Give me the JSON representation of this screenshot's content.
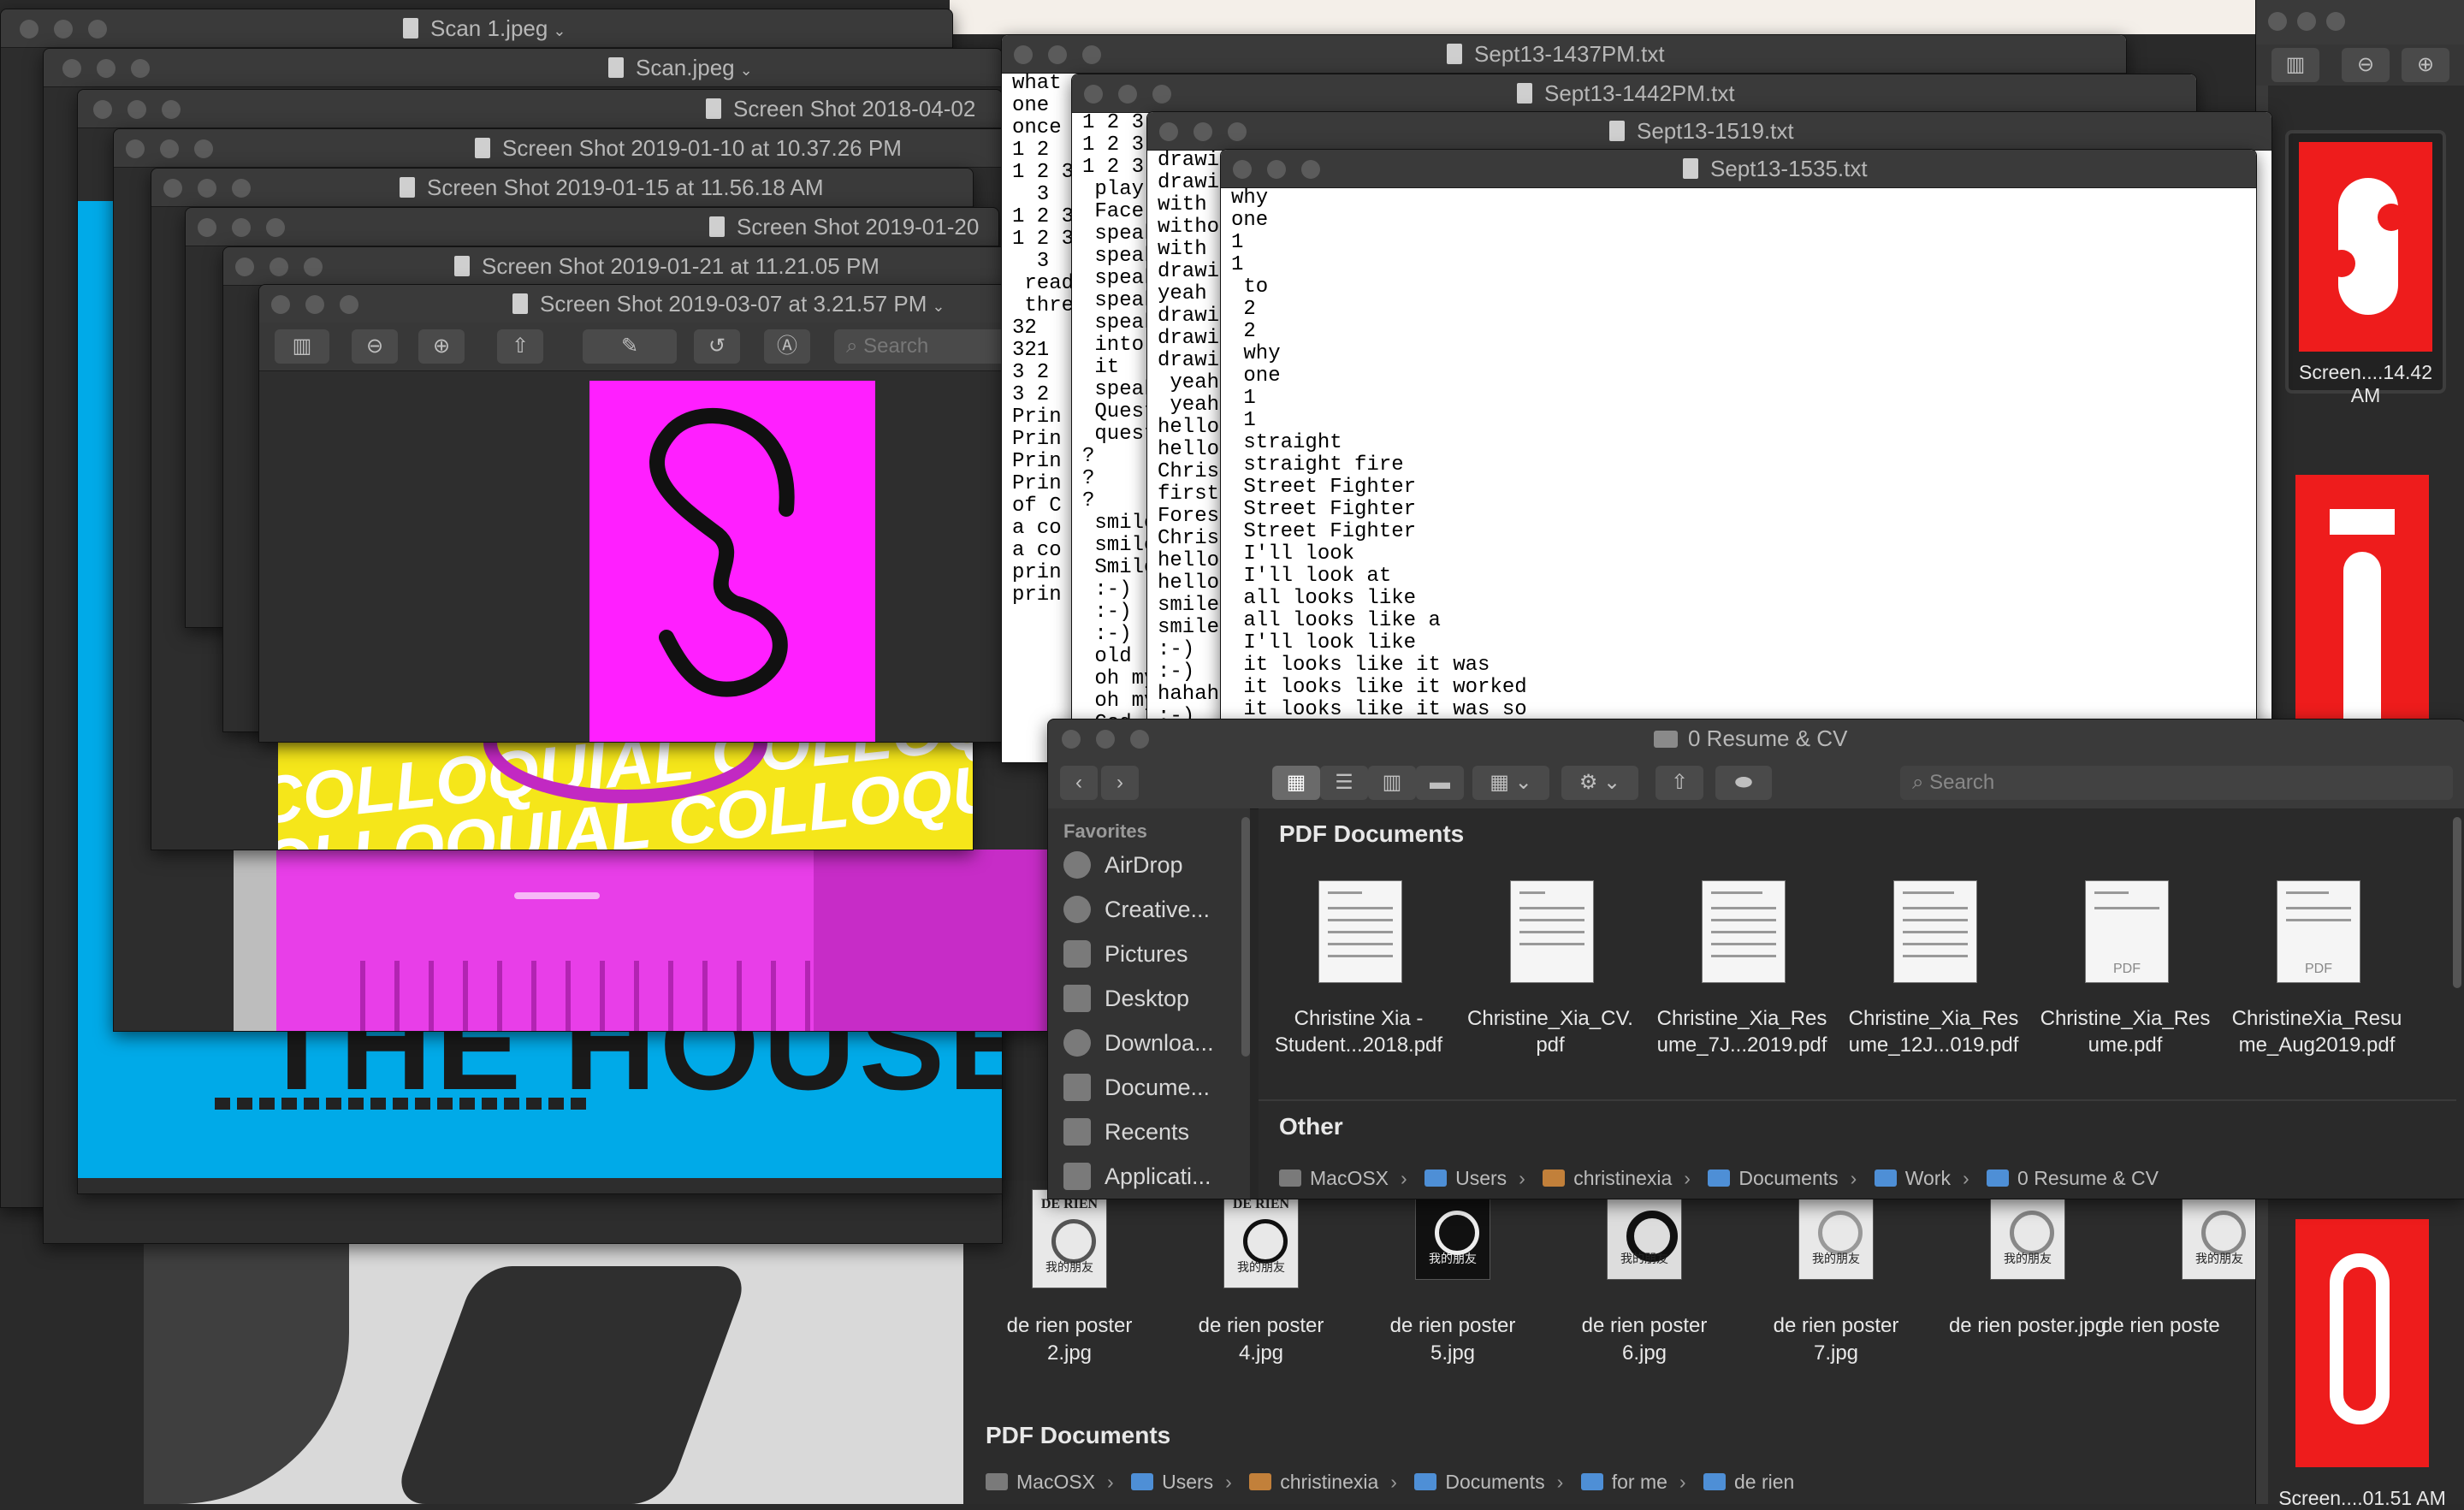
{
  "preview_windows": [
    {
      "title": "Scan 1.jpeg",
      "menu": true
    },
    {
      "title": "Scan.jpeg",
      "menu": true
    },
    {
      "title": "Screen Shot 2018-04-02"
    },
    {
      "title": "Screen Shot 2019-01-10 at 10.37.26 PM"
    },
    {
      "title": "Screen Shot 2019-01-15 at 11.56.18 AM"
    },
    {
      "title": "Screen Shot 2019-01-20"
    },
    {
      "title": "Screen Shot 2019-01-21 at 11.21.05 PM"
    },
    {
      "title": "Screen Shot 2019-03-07 at 3.21.57 PM",
      "menu": true
    }
  ],
  "preview_toolbar": {
    "search_placeholder": "Search"
  },
  "colloquial_text": "COLLOQUIAL",
  "house_text": "THE HOUSE",
  "text_windows": [
    {
      "title": "Sept13-1437PM.txt",
      "lines": [
        "what",
        "one",
        "once",
        "1 2",
        "1 2 3",
        "  3",
        "1 2 3",
        "1 2 3",
        "  3",
        " read",
        " three",
        "32",
        "321",
        "3 2",
        "3 2",
        "Prin",
        "Prin",
        "Prin",
        "Prin",
        "of C",
        "a co",
        "a co",
        "prin",
        "prin"
      ]
    },
    {
      "title": "Sept13-1442PM.txt",
      "lines": [
        "1 2 3",
        "1 2 3",
        "1 2 3",
        " play",
        " Face",
        " speak",
        " speak",
        " speak",
        " speak",
        " speak",
        " into",
        " it",
        " speak",
        " Quest",
        " quest",
        "?",
        "?",
        "?",
        "",
        " smile",
        " smile",
        " Smile",
        " :-)",
        " :-)",
        " :-)",
        " old",
        " oh my",
        " oh my",
        " God"
      ]
    },
    {
      "title": "Sept13-1519.txt",
      "lines": [
        "drawing",
        "drawing",
        "with",
        "without",
        "with",
        "drawing",
        "yeah",
        "drawing",
        "drawing",
        "drawing",
        " yeah",
        " yeah",
        "hello",
        "hello",
        "Christine",
        "first",
        "Forest",
        "Christine",
        "hello",
        "hello",
        "smile",
        "smile",
        ":-)",
        ":-)",
        "hahaha",
        ":-)"
      ]
    },
    {
      "title": "Sept13-1535.txt",
      "lines": [
        "why",
        "one",
        "1",
        "1",
        " to",
        " 2",
        " 2",
        " why",
        " one",
        " 1",
        " 1",
        " straight",
        " straight fire",
        " Street Fighter",
        " Street Fighter",
        " Street Fighter",
        " I'll look",
        " I'll look at",
        " all looks like",
        " all looks like a",
        " I'll look like",
        " it looks like it was",
        " it looks like it worked",
        " it looks like it was so"
      ]
    }
  ],
  "finder": {
    "title": "0 Resume & CV",
    "search_placeholder": "Search",
    "sidebar_header": "Favorites",
    "sidebar_items": [
      "AirDrop",
      "Creative...",
      "Pictures",
      "Desktop",
      "Downloa...",
      "Docume...",
      "Recents",
      "Applicati..."
    ],
    "section_pdf": "PDF Documents",
    "section_other": "Other",
    "files": [
      {
        "name": "Christine Xia - Student...2018.pdf"
      },
      {
        "name": "Christine_Xia_CV.pdf"
      },
      {
        "name": "Christine_Xia_Resume_7J...2019.pdf"
      },
      {
        "name": "Christine_Xia_Resume_12J...019.pdf"
      },
      {
        "name": "Christine_Xia_Resume.pdf"
      },
      {
        "name": "ChristineXia_Resume_Aug2019.pdf"
      }
    ],
    "file_lines": [
      [
        "Christine Xia -",
        "Student...2018.pdf"
      ],
      [
        "Christine_Xia_CV.",
        "pdf"
      ],
      [
        "Christine_Xia_Res",
        "ume_7J...2019.pdf"
      ],
      [
        "Christine_Xia_Res",
        "ume_12J...019.pdf"
      ],
      [
        "Christine_Xia_Res",
        "ume.pdf"
      ],
      [
        "ChristineXia_Resu",
        "me_Aug2019.pdf"
      ]
    ],
    "pdf_badge": "PDF",
    "path": [
      "MacOSX",
      "Users",
      "christinexia",
      "Documents",
      "Work",
      "0 Resume & CV"
    ]
  },
  "bg_finder": {
    "posters": [
      {
        "name_lines": [
          "de rien poster",
          "2.jpg"
        ]
      },
      {
        "name_lines": [
          "de rien poster",
          "4.jpg"
        ]
      },
      {
        "name_lines": [
          "de rien poster",
          "5.jpg"
        ]
      },
      {
        "name_lines": [
          "de rien poster",
          "6.jpg"
        ]
      },
      {
        "name_lines": [
          "de rien poster",
          "7.jpg"
        ]
      },
      {
        "name_lines": [
          "de rien poster.jpg",
          ""
        ]
      },
      {
        "name_lines": [
          "de rien poste",
          ""
        ]
      }
    ],
    "poster_brand": "DE RIEN",
    "poster_sub": "我的朋友",
    "section": "PDF Documents",
    "path": [
      "MacOSX",
      "Users",
      "christinexia",
      "Documents",
      "for me",
      "de rien"
    ]
  },
  "right_panel": {
    "items": [
      {
        "label": "Screen....14.42 AM"
      },
      {
        "label": ""
      },
      {
        "label": "Screen....01.51 AM"
      }
    ]
  },
  "colors": {
    "magenta": "#ff1fff",
    "blue": "#00aae8",
    "yellow": "#f5e61a",
    "red": "#ee1c1c"
  }
}
